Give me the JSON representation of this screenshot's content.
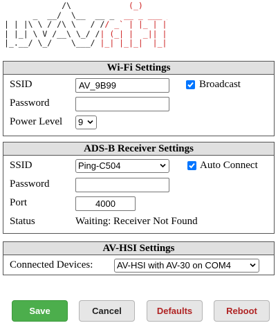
{
  "logo": {
    "text": "stratux",
    "line1_black": "  /\\  ",
    "line1_red": "    (_)      (_)",
    "line2_black": "__|  |_ __ __ _| |_ _   ___  ",
    "line3_black": "/ __| __| '__/ _` | __| | | \\ \\/ /",
    "line4_black": "\\__ \\ |_| | | (_| | |_| |_| |>  <",
    "line5_black": "|___/\\__|_|  \\__,_|\\__|\\__,_/_/\\_\\"
  },
  "wifi": {
    "title": "Wi-Fi Settings",
    "ssid_label": "SSID",
    "ssid_value": "AV_9B99",
    "broadcast_label": "Broadcast",
    "broadcast_checked": true,
    "password_label": "Password",
    "password_value": "",
    "power_label": "Power Level",
    "power_value": "9"
  },
  "adsb": {
    "title": "ADS-B Receiver Settings",
    "ssid_label": "SSID",
    "ssid_value": "Ping-C504",
    "auto_connect_label": "Auto Connect",
    "auto_connect_checked": true,
    "password_label": "Password",
    "password_value": "",
    "port_label": "Port",
    "port_value": "4000",
    "status_label": "Status",
    "status_value": "Waiting: Receiver Not Found"
  },
  "hsi": {
    "title": "AV-HSI Settings",
    "devices_label": "Connected Devices:",
    "devices_value": "AV-HSI with AV-30 on COM4"
  },
  "buttons": {
    "save": "Save",
    "cancel": "Cancel",
    "defaults": "Defaults",
    "reboot": "Reboot"
  },
  "colors": {
    "accent_checkbox": "#0075ff",
    "save_button": "#4cae4c",
    "danger_text": "#b02424",
    "logo_red": "#cc1b1b",
    "panel_header": "#e0e0e0"
  },
  "icons": {
    "checkbox": "checkmark-icon",
    "select": "chevron-down-icon"
  }
}
